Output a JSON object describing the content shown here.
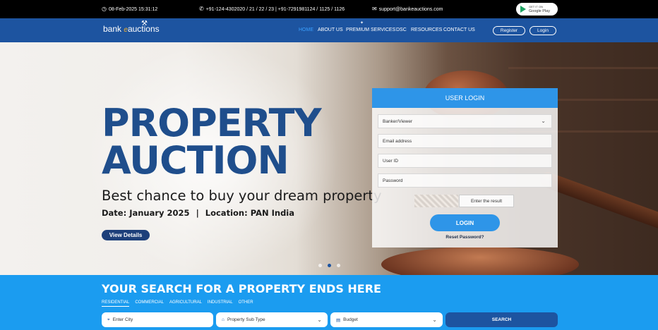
{
  "topbar": {
    "datetime": "08-Feb-2025 15:31:12",
    "phone": "+91-124-4302020 / 21 / 22 / 23 | +91-7291981124 / 1125 / 1126",
    "email": "support@bankeauctions.com",
    "gplay_small": "GET IT ON",
    "gplay_big": "Google Play"
  },
  "nav": {
    "logo_prefix": "bank",
    "logo_e": "e",
    "logo_suffix": "auctions",
    "items": [
      "HOME",
      "ABOUT US",
      "PREMIUM SERVICES",
      "DSC",
      "RESOURCES",
      "CONTACT US"
    ],
    "register": "Register",
    "login": "Login"
  },
  "hero": {
    "title_line1": "PROPERTY",
    "title_line2": "AUCTION",
    "subtitle": "Best chance to buy your dream property",
    "date": "Date: January 2025",
    "separator": "|",
    "location": "Location: PAN India",
    "button": "View Details",
    "slides": 3,
    "active_slide": 2
  },
  "login": {
    "title": "USER LOGIN",
    "role_select": "Banker/Viewer",
    "email_placeholder": "Email address",
    "userid_placeholder": "User ID",
    "password_placeholder": "Password",
    "captcha_placeholder": "Enter the result",
    "button": "LOGIN",
    "reset": "Reset Password?"
  },
  "search": {
    "title": "YOUR SEARCH FOR A PROPERTY ENDS HERE",
    "tabs": [
      "RESIDENTIAL",
      "COMMERCIAL",
      "AGRICULTURAL",
      "INDUSTRIAL",
      "OTHER"
    ],
    "city_placeholder": "Enter City",
    "subtype": "Property Sub Type",
    "budget": "Budget",
    "button": "SEARCH"
  },
  "colors": {
    "nav_blue": "#1d54a0",
    "accent_blue": "#2e95e8",
    "search_blue": "#1b9cf0",
    "title_blue": "#1f4e8c"
  }
}
